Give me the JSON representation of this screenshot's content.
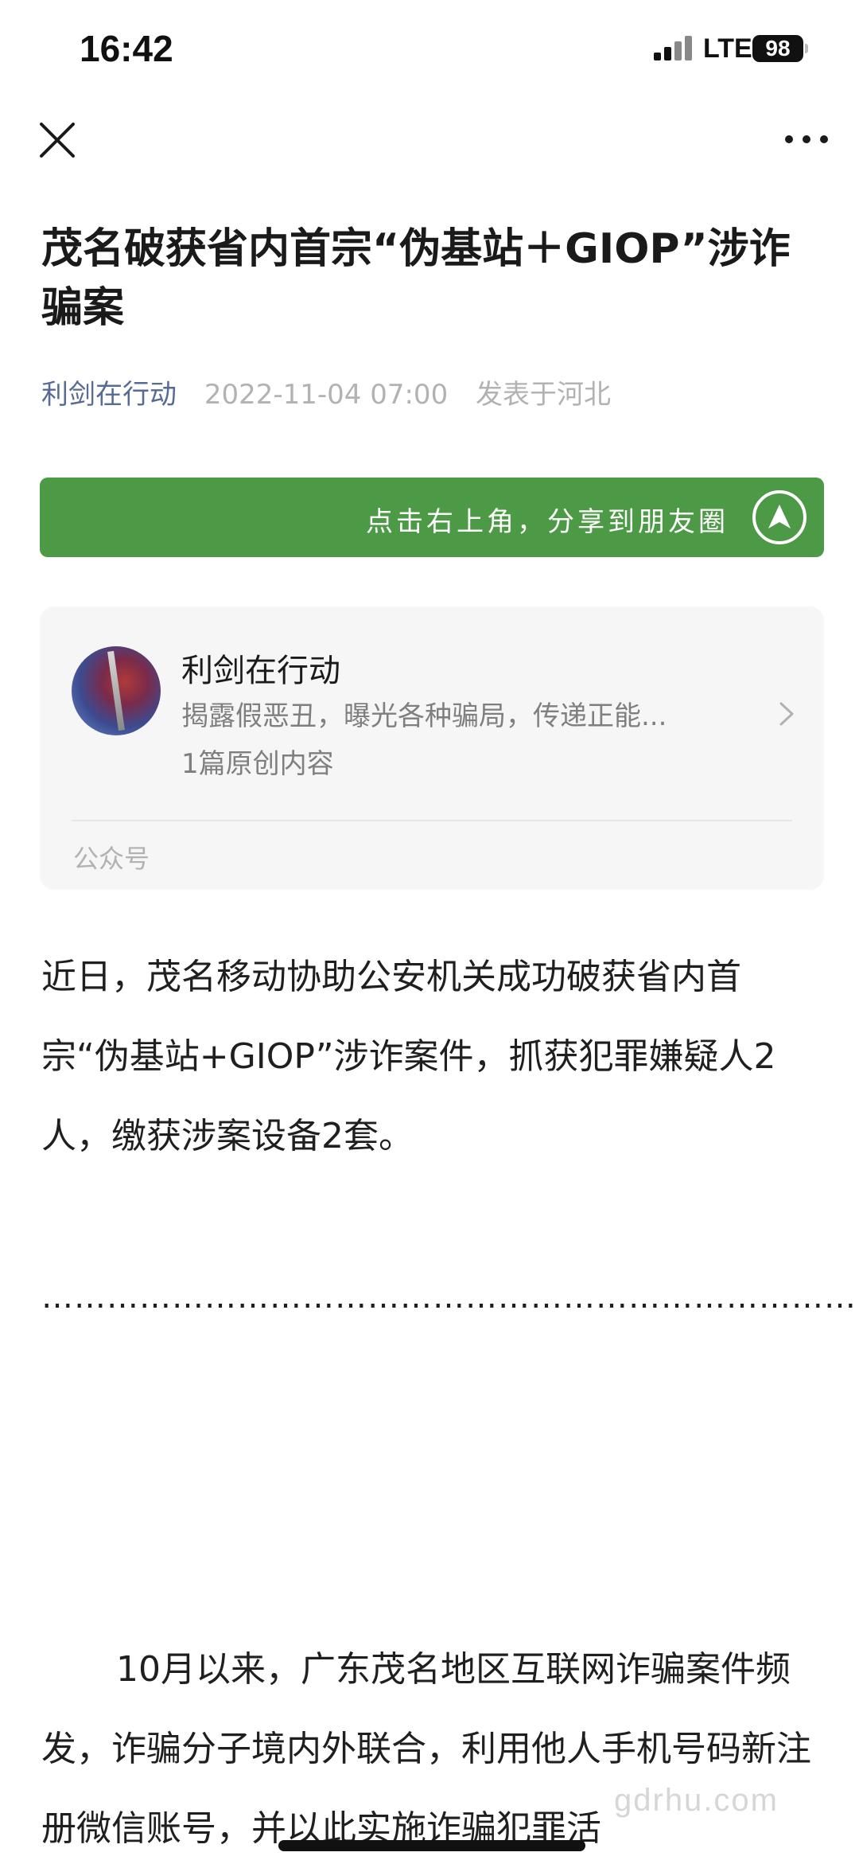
{
  "status_bar": {
    "time": "16:42",
    "network": "LTE",
    "battery": "98"
  },
  "nav": {
    "close_icon": "close-icon",
    "more_icon": "more-icon"
  },
  "article": {
    "title": "茂名破获省内首宗“伪基站＋GIOP”涉诈骗案",
    "author": "利剑在行动",
    "date": "2022-11-04 07:00",
    "location": "发表于河北"
  },
  "share_banner": {
    "text": "点击右上角，分享到朋友圈",
    "icon": "share-arrow-icon",
    "color": "#4c9a46"
  },
  "account_card": {
    "name": "利剑在行动",
    "description": "揭露假恶丑，曝光各种骗局，传递正能...",
    "original_count": "1篇原创内容",
    "type": "公众号"
  },
  "body": {
    "paragraph1": "近日，茂名移动协助公安机关成功破获省内首宗“伪基站+GIOP”涉诈案件，抓获犯罪嫌疑人2人，缴获涉案设备2套。",
    "dots": "……………………………………………………………………………………………………………………………………………………………………………………………………………………………………………………………………………………………………………………………………………………………………………………………………",
    "paragraph2": "10月以来，广东茂名地区互联网诈骗案件频发，诈骗分子境内外联合，利用他人手机号码新注册微信账号，并以此实施诈骗犯罪活"
  },
  "watermark": "gdrhu.com"
}
